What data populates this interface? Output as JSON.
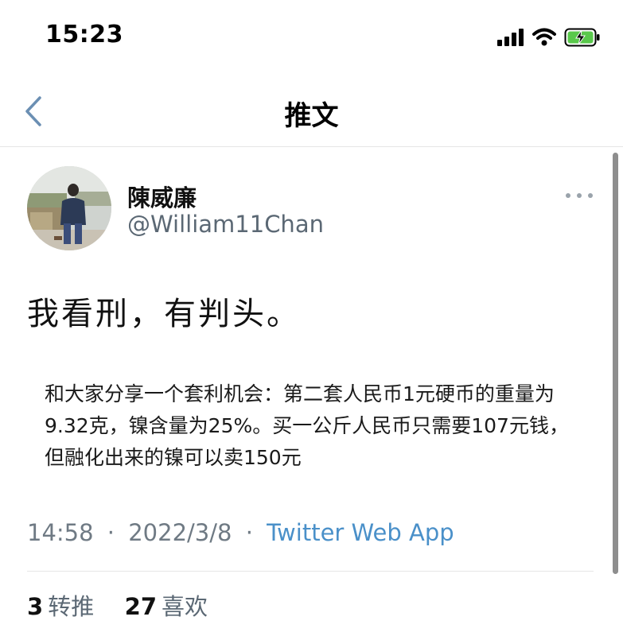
{
  "status_bar": {
    "time": "15:23",
    "icons": [
      "signal-icon",
      "wifi-icon",
      "battery-charging-icon"
    ]
  },
  "nav": {
    "back_icon": "chevron-left-icon",
    "title": "推文"
  },
  "tweet": {
    "author_name": "陳威廉",
    "author_handle": "@William11Chan",
    "text": "我看刑，有判头。",
    "quoted_text": "和大家分享一个套利机会：第二套人民币1元硬币的重量为9.32克，镍含量为25%。买一公斤人民币只需要107元钱，但融化出来的镍可以卖150元",
    "time": "14:58",
    "separator": "·",
    "date": "2022/3/8",
    "source": "Twitter Web App",
    "retweets_count": "3",
    "retweets_label": "转推",
    "likes_count": "27",
    "likes_label": "喜欢"
  },
  "colors": {
    "link": "#4a90c9",
    "secondary_text": "#6f7a84",
    "nav_accent": "#6b8fb3"
  }
}
